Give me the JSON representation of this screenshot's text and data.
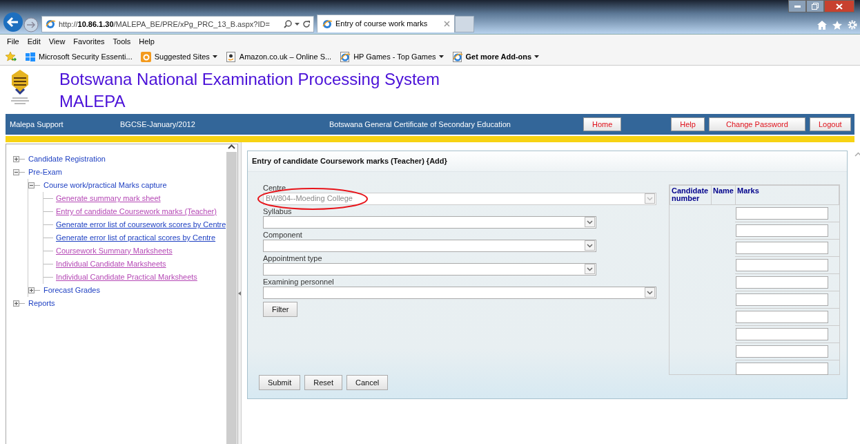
{
  "browser": {
    "address": "http://**10.86.1.30**/MALEPA_BE/PRE/xPg_PRC_13_B.aspx?ID=",
    "tab": {
      "title": "Entry of course work marks",
      "selected": true
    }
  },
  "menu": [
    "File",
    "Edit",
    "View",
    "Favorites",
    "Tools",
    "Help"
  ],
  "favorites": [
    {
      "label": "Microsoft Security Essenti...",
      "kind": "windows",
      "dropdown": false,
      "bold": false
    },
    {
      "label": "Suggested Sites",
      "kind": "suggested",
      "dropdown": true,
      "bold": false
    },
    {
      "label": "Amazon.co.uk – Online S...",
      "kind": "page",
      "dropdown": false,
      "bold": false
    },
    {
      "label": "HP Games - Top Games",
      "kind": "browser",
      "dropdown": true,
      "bold": false
    },
    {
      "label": "Get more Add-ons",
      "kind": "browser",
      "dropdown": true,
      "bold": true
    }
  ],
  "header": {
    "title": "Botswana National Examination Processing System",
    "subtitle": "MALEPA"
  },
  "nav_bar": {
    "items": [
      "Malepa Support",
      "BGCSE-January/2012",
      "Botswana General Certificate of Secondary Education"
    ],
    "buttons": [
      "Home",
      "Help",
      "Change Password",
      "Logout"
    ]
  },
  "tree": [
    {
      "kind": "branch",
      "label": "Candidate Registration",
      "expanded": false
    },
    {
      "kind": "branch",
      "label": "Pre-Exam",
      "expanded": true,
      "children": [
        {
          "kind": "branch",
          "label": "Course work/practical Marks capture",
          "expanded": true,
          "children": [
            {
              "kind": "leaf",
              "label": "Generate summary mark sheet",
              "visited": true
            },
            {
              "kind": "leaf",
              "label": "Entry of candidate Coursework marks (Teacher)",
              "visited": true
            },
            {
              "kind": "leaf",
              "label": "Generate error list of coursework scores by Centre",
              "visited": false
            },
            {
              "kind": "leaf",
              "label": "Generate error list of practical scores by Centre",
              "visited": false
            },
            {
              "kind": "leaf",
              "label": "Coursework Summary Marksheets",
              "visited": true
            },
            {
              "kind": "leaf",
              "label": "Individual Candidate Marksheets",
              "visited": true
            },
            {
              "kind": "leaf",
              "label": "Individual Candidate Practical Marksheets",
              "visited": true
            }
          ]
        },
        {
          "kind": "branch",
          "label": "Forecast Grades",
          "expanded": false
        }
      ]
    },
    {
      "kind": "branch",
      "label": "Reports",
      "expanded": false
    }
  ],
  "panel": {
    "title": "Entry of candidate Coursework marks (Teacher) {Add}",
    "fields": [
      {
        "label": "Centre",
        "value": "BW804--Moeding College",
        "disabled": true,
        "wide": true,
        "annotated": true
      },
      {
        "label": "Syllabus",
        "disabled": false,
        "wide": false,
        "annotated": false
      },
      {
        "label": "Component",
        "disabled": false,
        "wide": false,
        "annotated": false
      },
      {
        "label": "Appointment type",
        "disabled": false,
        "wide": false,
        "annotated": false
      },
      {
        "label": "Examining personnel",
        "disabled": false,
        "wide": true,
        "annotated": false
      }
    ],
    "filter_button": "Filter",
    "table": {
      "columns": [
        "Candidate number",
        "Name",
        "Marks"
      ]
    },
    "actions": [
      "Submit",
      "Reset",
      "Cancel"
    ]
  }
}
